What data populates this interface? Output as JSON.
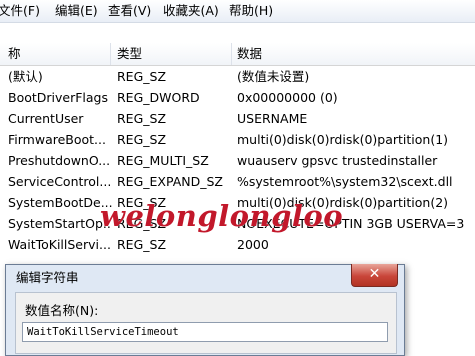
{
  "menu": {
    "items": [
      "文件(F)",
      "编辑(E)",
      "查看(V)",
      "收藏夹(A)",
      "帮助(H)"
    ]
  },
  "columns": {
    "name": "称",
    "type": "类型",
    "data": "数据"
  },
  "rows": [
    {
      "name": "(默认)",
      "type": "REG_SZ",
      "data": "(数值未设置)"
    },
    {
      "name": "BootDriverFlags",
      "type": "REG_DWORD",
      "data": "0x00000000 (0)"
    },
    {
      "name": "CurrentUser",
      "type": "REG_SZ",
      "data": "USERNAME"
    },
    {
      "name": "FirmwareBoot...",
      "type": "REG_SZ",
      "data": "multi(0)disk(0)rdisk(0)partition(1)"
    },
    {
      "name": "PreshutdownO...",
      "type": "REG_MULTI_SZ",
      "data": "wuauserv gpsvc trustedinstaller"
    },
    {
      "name": "ServiceControl...",
      "type": "REG_EXPAND_SZ",
      "data": "%systemroot%\\system32\\scext.dll"
    },
    {
      "name": "SystemBootDe...",
      "type": "REG_SZ",
      "data": "multi(0)disk(0)rdisk(0)partition(2)"
    },
    {
      "name": "SystemStartOp...",
      "type": "REG_SZ",
      "data": "NOEXECUTE=OPTIN  3GB  USERVA=3"
    },
    {
      "name": "WaitToKillServi...",
      "type": "REG_SZ",
      "data": "2000"
    }
  ],
  "watermark": "welonglongloo",
  "dialog": {
    "title": "编辑字符串",
    "close_glyph": "✕",
    "value_name_label": "数值名称(N):",
    "value_name": "WaitToKillServiceTimeout"
  }
}
